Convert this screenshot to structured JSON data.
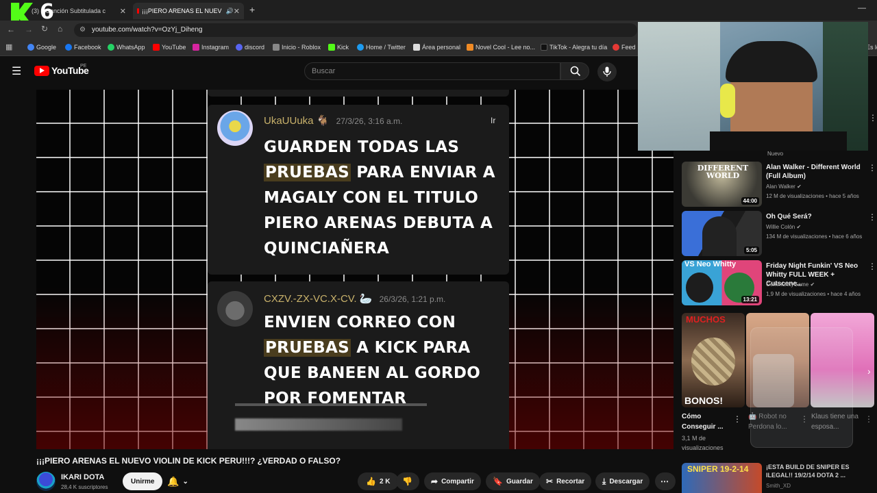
{
  "browser": {
    "tabs": [
      {
        "label": "(3) ♪ Canción Subtitulada c"
      },
      {
        "label": "¡¡¡PIERO ARENAS EL NUEV"
      }
    ],
    "new_tab": "+",
    "url": "youtube.com/watch?v=OzYj_Diheng",
    "bookmarks": [
      "Google",
      "Facebook",
      "WhatsApp",
      "YouTube",
      "Instagram",
      "discord",
      "Inicio - Roblox",
      "Kick",
      "Home / Twitter",
      "Área personal",
      "Novel Cool - Lee no...",
      "TikTok - Alegra tu día",
      "Feed",
      "Es los"
    ]
  },
  "overlay": {
    "kick_counter": "6"
  },
  "youtube": {
    "logo": "YouTube",
    "region": "PE",
    "search_placeholder": "Buscar"
  },
  "video": {
    "comments": [
      {
        "author": "UkaUUuka",
        "time": "27/3/26, 3:16 a.m.",
        "action": "Ir",
        "lines": [
          [
            "GUARDEN TODAS LAS"
          ],
          [
            "PRUEBAS",
            " PARA ENVIAR A"
          ],
          [
            "MAGALY CON EL TITULO"
          ],
          [
            "PIERO ARENAS DEBUTA A"
          ],
          [
            "QUINCIAÑERA"
          ]
        ]
      },
      {
        "author": "CXZV.-ZX-VC.X-CV.",
        "time": "26/3/26, 1:21 p.m.",
        "lines": [
          [
            "ENVIEN CORREO CON"
          ],
          [
            "PRUEBAS",
            " A KICK PARA"
          ],
          [
            "QUE BANEEN AL GORDO"
          ],
          [
            "POR FOMENTAR"
          ]
        ]
      }
    ]
  },
  "sidebar": {
    "tag_new": "Nuevo",
    "recs": [
      {
        "title": "Alan Walker - Different World (Full Album)",
        "channel": "Alan Walker",
        "meta": "12 M de visualizaciones • hace 5 años",
        "duration": "44:00",
        "thumb_text": "DIFFERENT WORLD"
      },
      {
        "title": "Oh Qué Será?",
        "channel": "Willie Colón",
        "meta": "134 M de visualizaciones • hace 6 años",
        "duration": "5:05"
      },
      {
        "title": "Friday Night Funkin' VS Neo Whitty FULL WEEK + Cutscene...",
        "channel": "CommunityGame",
        "meta": "1,9 M de visualizaciones • hace 4 años",
        "duration": "13:21",
        "thumb_text": "VS Neo Whitty"
      }
    ],
    "shorts": [
      {
        "title": "Cómo Conseguir ...",
        "views": "3,1 M de visualizaciones",
        "top_text": "MUCHOS",
        "bottom_text": "BONOS!"
      },
      {
        "title": "Robot no Perdona lo..."
      },
      {
        "title": "Klaus tiene una esposa..."
      }
    ],
    "last_rec": {
      "title": "¡ESTA BUILD DE SNIPER ES ILEGAL!! 19/2/14 DOTA 2 ...",
      "channel": "Smith_XD",
      "thumb_text": "SNIPER 19-2-14"
    }
  },
  "info": {
    "title": "¡¡¡PIERO ARENAS EL NUEVO VIOLIN DE KICK PERU!!!? ¿VERDAD O FALSO?",
    "channel": "IKARI DOTA",
    "subscribers": "28,4 K suscriptores",
    "join": "Unirme",
    "likes": "2 K",
    "share": "Compartir",
    "save": "Guardar",
    "clip": "Recortar",
    "download": "Descargar"
  },
  "colors": {
    "accent_red": "#ff0000",
    "kick_green": "#53fc18",
    "highlight": "#4a3d1e"
  }
}
